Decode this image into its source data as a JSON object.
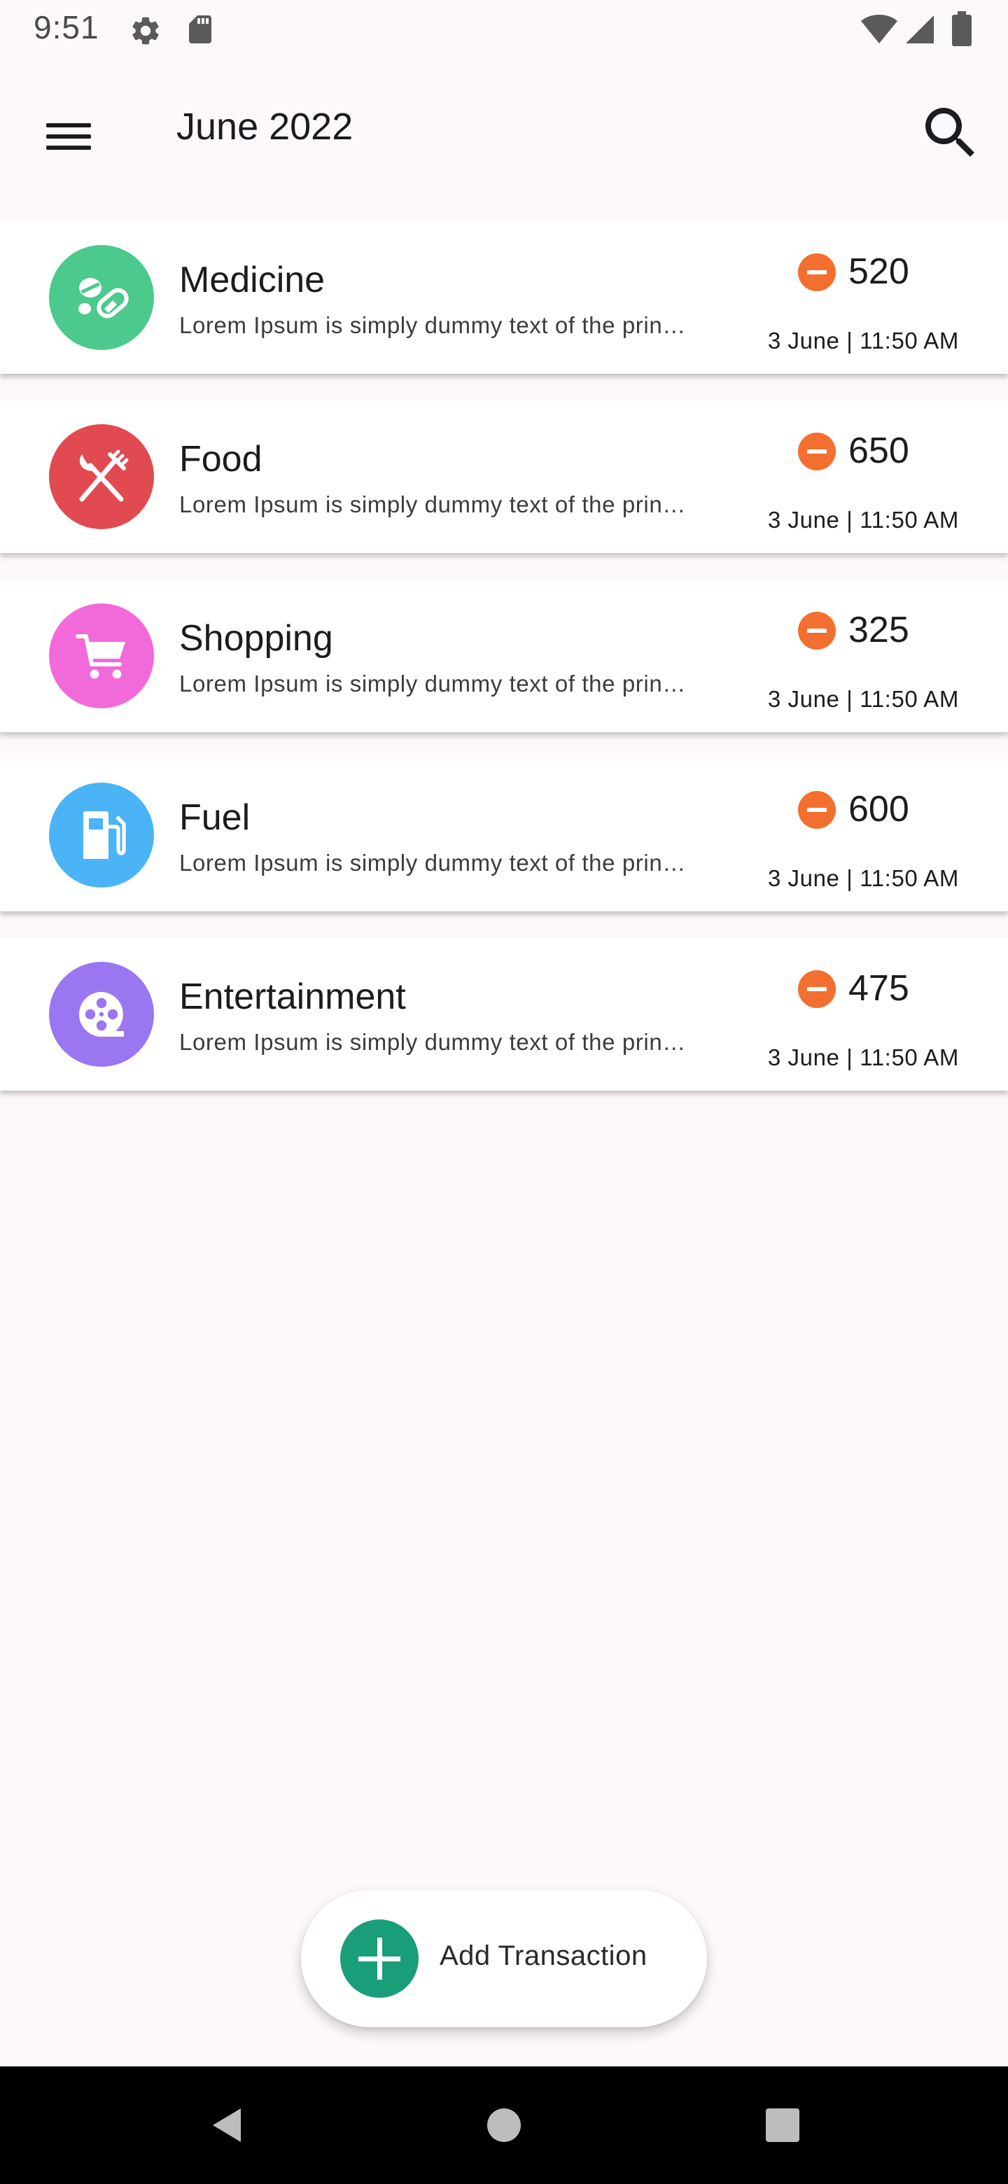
{
  "status_bar": {
    "time": "9:51",
    "icons": [
      "settings-icon",
      "sd-card-icon",
      "wifi-icon",
      "cell-signal-icon",
      "battery-icon"
    ]
  },
  "app_bar": {
    "title": "June 2022",
    "menu_icon": "menu-icon",
    "search_icon": "search-icon"
  },
  "transactions": [
    {
      "category": "Medicine",
      "description": "Lorem Ipsum is simply dummy text of the printing and typesetting industry",
      "amount": "520",
      "date": "3 June | 11:50 AM",
      "icon": "pills-icon",
      "color": "#4cc98c"
    },
    {
      "category": "Food",
      "description": "Lorem Ipsum is simply dummy text of the printing and typesetting industry",
      "amount": "650",
      "date": "3 June | 11:50 AM",
      "icon": "fork-knife-icon",
      "color": "#e04a50"
    },
    {
      "category": "Shopping",
      "description": "Lorem Ipsum is simply dummy text of the printing and typesetting industry",
      "amount": "325",
      "date": "3 June | 11:50 AM",
      "icon": "shopping-cart-icon",
      "color": "#f26ad9"
    },
    {
      "category": "Fuel",
      "description": "Lorem Ipsum is simply dummy text of the printing and typesetting industry",
      "amount": "600",
      "date": "3 June | 11:50 AM",
      "icon": "fuel-pump-icon",
      "color": "#4ab4f6"
    },
    {
      "category": "Entertainment",
      "description": "Lorem Ipsum is simply dummy text of the printing and typesetting industry",
      "amount": "475",
      "date": "3 June | 11:50 AM",
      "icon": "film-reel-icon",
      "color": "#9a76f0"
    }
  ],
  "expense_indicator": {
    "icon": "minus-circle-icon",
    "color": "#f26f2f"
  },
  "fab": {
    "label": "Add Transaction",
    "icon": "plus-icon",
    "color": "#1a9e7a"
  },
  "nav_bar": {
    "icons": [
      "back-icon",
      "home-icon",
      "recents-icon"
    ]
  }
}
